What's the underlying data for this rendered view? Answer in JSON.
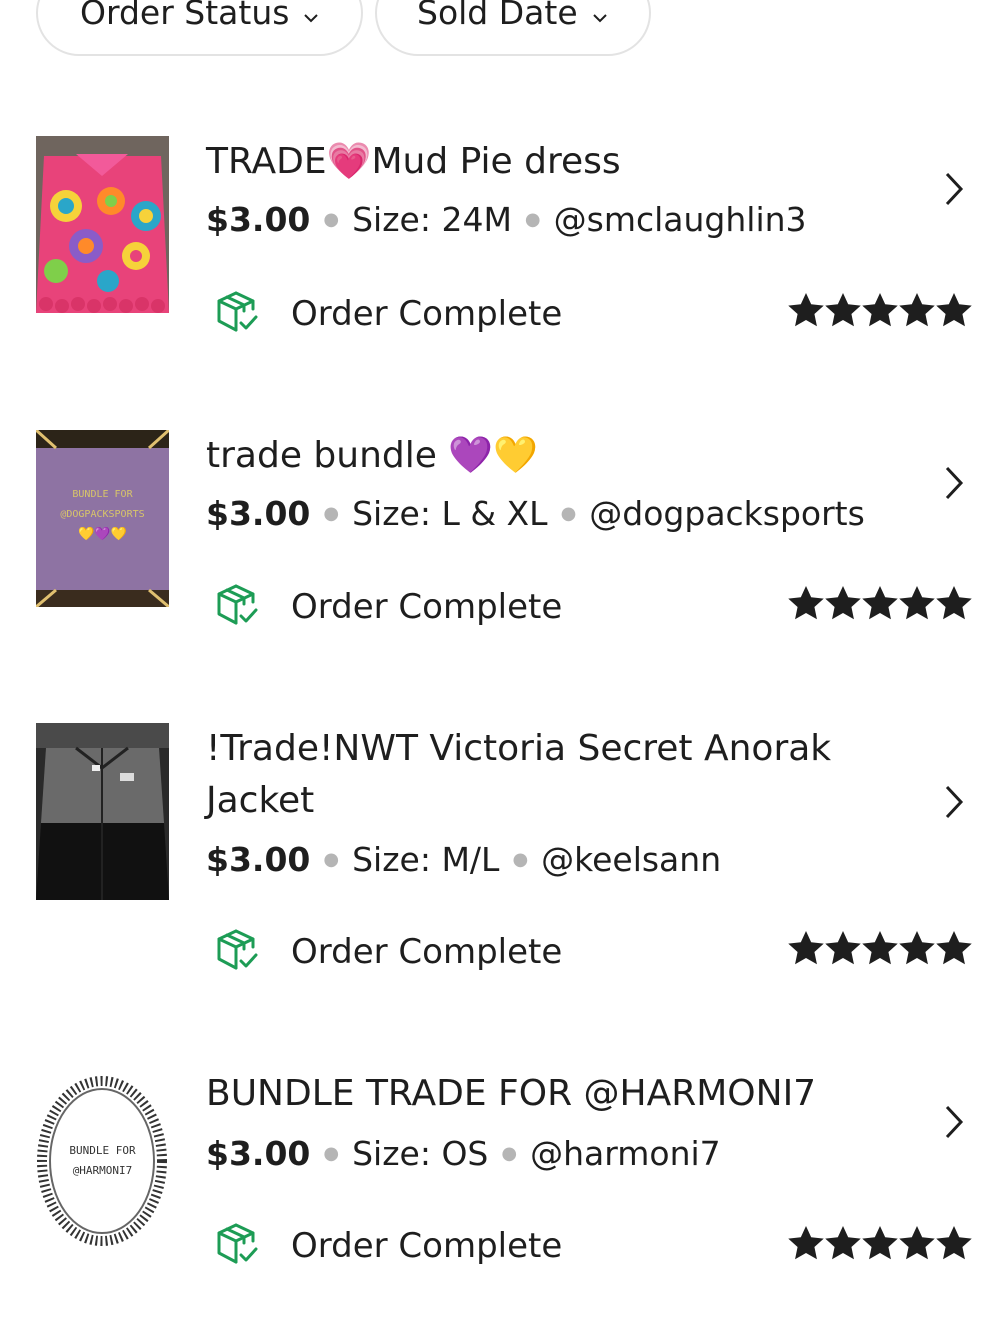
{
  "filters": {
    "order_status": "Order Status",
    "sold_date": "Sold Date"
  },
  "listings": [
    {
      "title": "TRADE💗Mud Pie dress",
      "price": "$3.00",
      "size": "Size: 24M",
      "user": "@smclaughlin3",
      "status": "Order Complete",
      "rating": 5
    },
    {
      "title": "trade bundle 💜💛",
      "price": "$3.00",
      "size": "Size: L & XL",
      "user": "@dogpacksports",
      "status": "Order Complete",
      "rating": 5,
      "thumb_text": [
        "BUNDLE FOR",
        "@DOGPACKSPORTS",
        "💛💜💛"
      ]
    },
    {
      "title": "!Trade!NWT Victoria Secret Anorak Jacket",
      "price": "$3.00",
      "size": "Size: M/L",
      "user": "@keelsann",
      "status": "Order Complete",
      "rating": 5
    },
    {
      "title": "BUNDLE TRADE FOR @HARMONI7",
      "price": "$3.00",
      "size": "Size: OS",
      "user": "@harmoni7",
      "status": "Order Complete",
      "rating": 5,
      "thumb_text": [
        "BUNDLE FOR",
        "@HARMONI7"
      ]
    }
  ],
  "colors": {
    "status_icon": "#1d9c55",
    "stars": "#1e1e1e",
    "pill_border": "#e3e3e3",
    "separator_dot": "#b5b5b5"
  },
  "icons": {
    "filter_chevron": "chevron-down-icon",
    "row_chevron": "chevron-right-icon",
    "status": "package-check-icon",
    "rating": "star-icon"
  }
}
